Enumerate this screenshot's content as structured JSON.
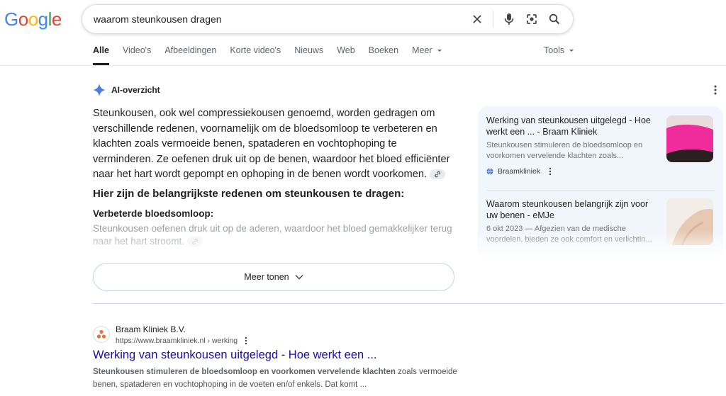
{
  "logo": {
    "letters": [
      "G",
      "o",
      "o",
      "g",
      "l",
      "e"
    ],
    "colors": [
      "#4285F4",
      "#EA4335",
      "#FBBC05",
      "#4285F4",
      "#34A853",
      "#EA4335"
    ]
  },
  "search": {
    "query": "waarom steunkousen dragen"
  },
  "tabs": [
    {
      "label": "Alle"
    },
    {
      "label": "Video's"
    },
    {
      "label": "Afbeeldingen"
    },
    {
      "label": "Korte video's"
    },
    {
      "label": "Nieuws"
    },
    {
      "label": "Web"
    },
    {
      "label": "Boeken"
    },
    {
      "label": "Meer"
    }
  ],
  "tools_label": "Tools",
  "ai_overview": {
    "label": "AI-overzicht",
    "intro": "Steunkousen, ook wel compressiekousen genoemd, worden gedragen om verschillende redenen, voornamelijk om de bloedsomloop te verbeteren en klachten zoals vermoeide benen, spataderen en vochtophoping te verminderen. Ze oefenen druk uit op de benen, waardoor het bloed efficiënter naar het hart wordt gepompt en ophoping in de benen wordt voorkomen.",
    "subheading": "Hier zijn de belangrijkste redenen om steunkousen te dragen:",
    "point_title": "Verbeterde bloedsomloop:",
    "point_text": "Steunkousen oefenen druk uit op de aderen, waardoor het bloed gemakkelijker terug naar het hart stroomt.",
    "more_label": "Meer tonen"
  },
  "sources": [
    {
      "title": "Werking van steunkousen uitgelegd - Hoe werkt een ... - Braam Kliniek",
      "snippet": "Steunkousen stimuleren de bloedsomloop en voorkomen vervelende klachten zoals...",
      "source": "Braamkliniek"
    },
    {
      "title": "Waarom steunkousen belangrijk zijn voor uw benen - eMJe",
      "snippet": "6 okt 2023 — Afgezien van de medische voordelen, bieden ze ook comfort en verlichtin..."
    }
  ],
  "result": {
    "site": "Braam Kliniek B.V.",
    "url": "https://www.braamkliniek.nl › werking",
    "title": "Werking van steunkousen uitgelegd - Hoe werkt een ...",
    "snippet_bold": "Steunkousen stimuleren de bloedsomloop en voorkomen vervelende klachten",
    "snippet_rest": " zoals vermoeide benen, spataderen en vochtophoping in de voeten en/of enkels. Dat komt ..."
  }
}
